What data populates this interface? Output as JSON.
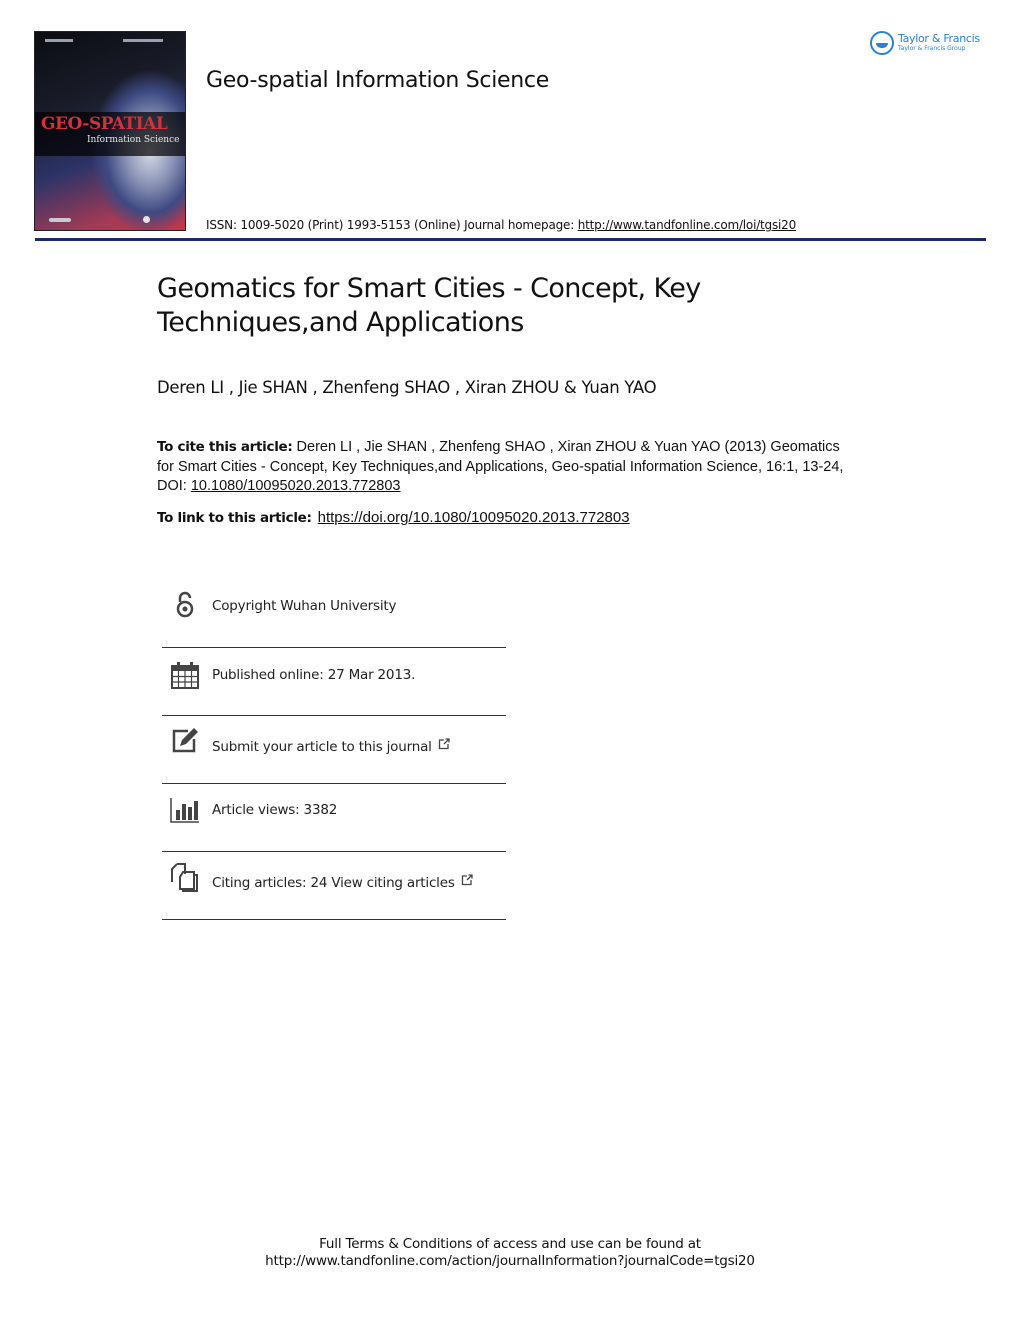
{
  "journal": {
    "title": "Geo-spatial Information Science",
    "issn_text": "ISSN: 1009-5020 (Print) 1993-5153 (Online) Journal homepage: ",
    "homepage_link": "http://www.tandfonline.com/loi/tgsi20",
    "cover": {
      "title_main": "GEO-SPATIAL",
      "title_sub": "Information Science"
    }
  },
  "publisher": {
    "name": "Taylor & Francis",
    "group": "Taylor & Francis Group",
    "brand_color": "#2e7fcf"
  },
  "rule_color": "#1a2a6c",
  "article": {
    "title": "Geomatics for Smart Cities - Concept, Key Techniques,and Applications",
    "authors": "Deren LI , Jie SHAN , Zhenfeng SHAO , Xiran ZHOU & Yuan YAO"
  },
  "citation": {
    "label": "To cite this article:",
    "text": " Deren LI , Jie SHAN , Zhenfeng SHAO , Xiran ZHOU & Yuan YAO (2013) Geomatics for Smart Cities - Concept, Key Techniques,and Applications, Geo-spatial Information Science, 16:1, 13-24, DOI: ",
    "doi": "10.1080/10095020.2013.772803"
  },
  "link": {
    "label": "To link to this article:",
    "url": "https://doi.org/10.1080/10095020.2013.772803"
  },
  "info_items": [
    {
      "icon": "open-access-icon",
      "label": "Copyright Wuhan University",
      "external": false
    },
    {
      "icon": "calendar-icon",
      "label": "Published online: 27 Mar 2013.",
      "external": false
    },
    {
      "icon": "edit-icon",
      "label": "Submit your article to this journal",
      "external": true
    },
    {
      "icon": "bar-chart-icon",
      "label": "Article views: 3382",
      "external": false
    },
    {
      "icon": "documents-icon",
      "label": "Citing articles: 24 View citing articles",
      "external": true
    }
  ],
  "footer": {
    "line1": "Full Terms & Conditions of access and use can be found at",
    "line2": "http://www.tandfonline.com/action/journalInformation?journalCode=tgsi20"
  }
}
